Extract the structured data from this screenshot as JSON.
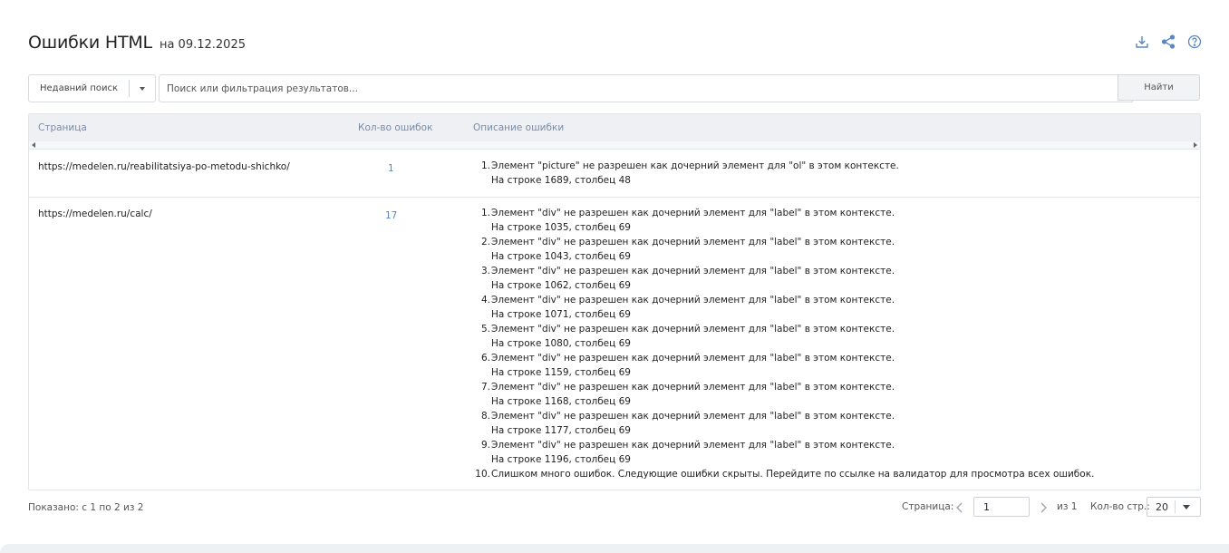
{
  "header": {
    "title": "Ошибки HTML",
    "subtitle": "на 09.12.2025"
  },
  "actions": [
    {
      "icon": "download-icon"
    },
    {
      "icon": "share-icon"
    },
    {
      "icon": "help-icon"
    }
  ],
  "search": {
    "recent_label": "Недавний поиск",
    "placeholder": "Поиск или фильтрация результатов...",
    "value": "",
    "find_label": "Найти"
  },
  "table": {
    "columns": [
      "Страница",
      "Кол-во ошибок",
      "Описание ошибки"
    ],
    "rows": [
      {
        "page": "https://medelen.ru/reabilitatsiya-po-metodu-shichko/",
        "count": "1",
        "errors": [
          {
            "num": "1.",
            "line1": "Элемент \"picture\" не разрешен как дочерний элемент для \"ol\" в этом контексте.",
            "line2": "На строке 1689, столбец 48"
          }
        ]
      },
      {
        "page": "https://medelen.ru/calc/",
        "count": "17",
        "errors": [
          {
            "num": "1.",
            "line1": "Элемент \"div\" не разрешен как дочерний элемент для \"label\" в этом контексте.",
            "line2": "На строке 1035, столбец 69"
          },
          {
            "num": "2.",
            "line1": "Элемент \"div\" не разрешен как дочерний элемент для \"label\" в этом контексте.",
            "line2": "На строке 1043, столбец 69"
          },
          {
            "num": "3.",
            "line1": "Элемент \"div\" не разрешен как дочерний элемент для \"label\" в этом контексте.",
            "line2": "На строке 1062, столбец 69"
          },
          {
            "num": "4.",
            "line1": "Элемент \"div\" не разрешен как дочерний элемент для \"label\" в этом контексте.",
            "line2": "На строке 1071, столбец 69"
          },
          {
            "num": "5.",
            "line1": "Элемент \"div\" не разрешен как дочерний элемент для \"label\" в этом контексте.",
            "line2": "На строке 1080, столбец 69"
          },
          {
            "num": "6.",
            "line1": "Элемент \"div\" не разрешен как дочерний элемент для \"label\" в этом контексте.",
            "line2": "На строке 1159, столбец 69"
          },
          {
            "num": "7.",
            "line1": "Элемент \"div\" не разрешен как дочерний элемент для \"label\" в этом контексте.",
            "line2": "На строке 1168, столбец 69"
          },
          {
            "num": "8.",
            "line1": "Элемент \"div\" не разрешен как дочерний элемент для \"label\" в этом контексте.",
            "line2": "На строке 1177, столбец 69"
          },
          {
            "num": "9.",
            "line1": "Элемент \"div\" не разрешен как дочерний элемент для \"label\" в этом контексте.",
            "line2": "На строке 1196, столбец 69"
          },
          {
            "num": "10.",
            "line1": "Слишком много ошибок. Следующие ошибки скрыты. Перейдите по ссылке на валидатор для просмотра всех ошибок.",
            "line2": ""
          }
        ]
      }
    ]
  },
  "footer": {
    "shown": "Показано: с 1 по 2 из 2",
    "page_label": "Страница:",
    "page_value": "1",
    "of_label": "из 1",
    "per_page_label": "Кол-во стр.:",
    "per_page_value": "20"
  },
  "colors": {
    "accent": "#5b87c5",
    "header_bg": "#eef0f4",
    "header_text": "#7a8ca5"
  }
}
